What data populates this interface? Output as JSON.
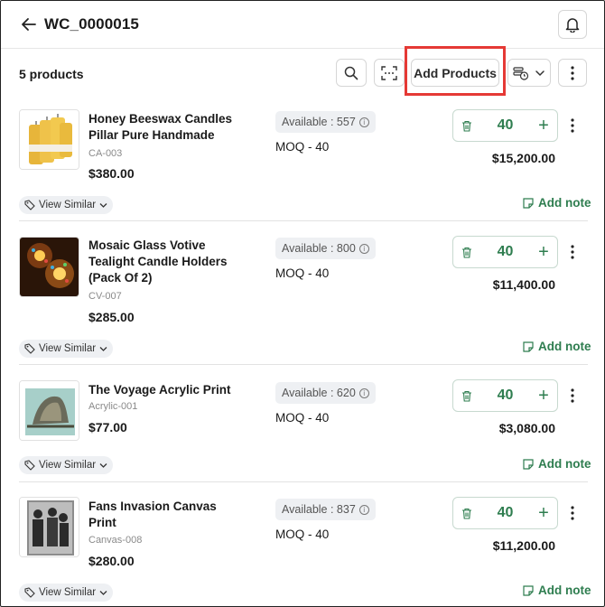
{
  "header": {
    "title": "WC_0000015"
  },
  "toolbar": {
    "count": "5 products",
    "add_products_label": "Add Products"
  },
  "colors": {
    "accent_green": "#2e7d4f",
    "highlight_red": "#e53935",
    "chip_bg": "#eef0f3"
  },
  "products": [
    {
      "name": "Honey Beeswax Candles Pillar Pure Handmade",
      "sku": "CA-003",
      "price": "$380.00",
      "available": "Available : 557",
      "moq": "MOQ - 40",
      "qty": "40",
      "total": "$15,200.00",
      "view_similar": "View Similar",
      "add_note": "Add note"
    },
    {
      "name": "Mosaic Glass Votive Tealight Candle Holders (Pack Of 2)",
      "sku": "CV-007",
      "price": "$285.00",
      "available": "Available : 800",
      "moq": "MOQ - 40",
      "qty": "40",
      "total": "$11,400.00",
      "view_similar": "View Similar",
      "add_note": "Add note"
    },
    {
      "name": "The Voyage Acrylic Print",
      "sku": "Acrylic-001",
      "price": "$77.00",
      "available": "Available : 620",
      "moq": "MOQ - 40",
      "qty": "40",
      "total": "$3,080.00",
      "view_similar": "View Similar",
      "add_note": "Add note"
    },
    {
      "name": "Fans Invasion Canvas Print",
      "sku": "Canvas-008",
      "price": "$280.00",
      "available": "Available : 837",
      "moq": "MOQ - 40",
      "qty": "40",
      "total": "$11,200.00",
      "view_similar": "View Similar",
      "add_note": "Add note"
    }
  ]
}
